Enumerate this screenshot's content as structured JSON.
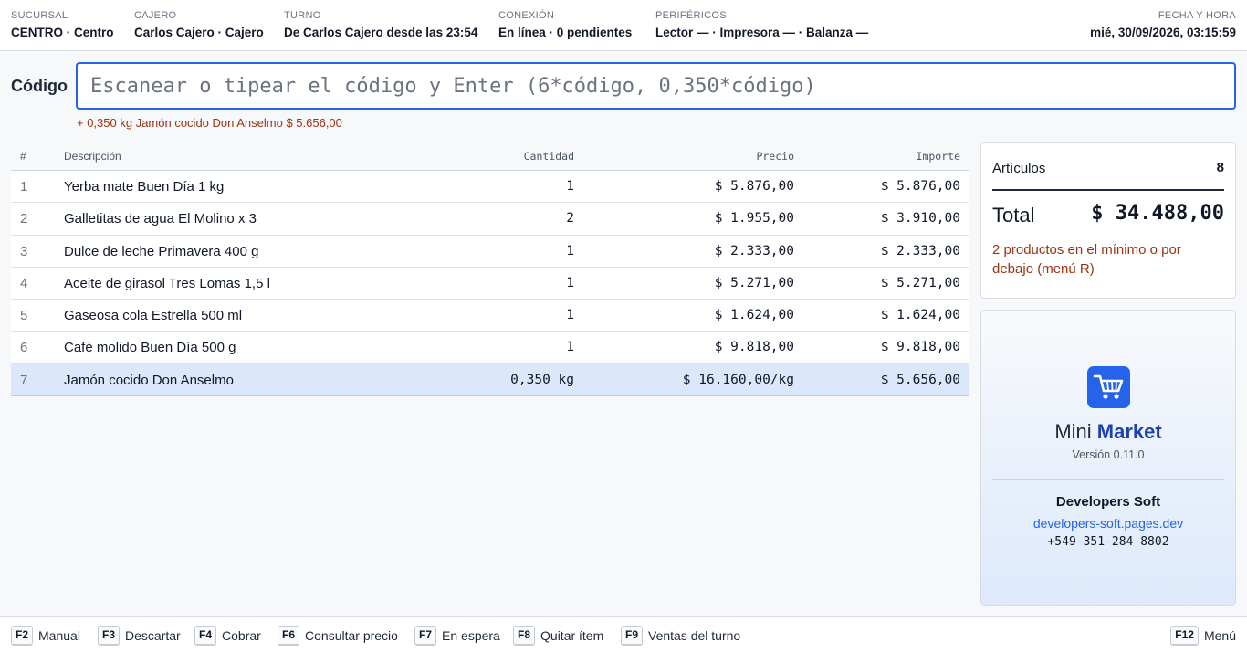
{
  "header": {
    "branch": {
      "label": "SUCURSAL",
      "value": "CENTRO · Centro"
    },
    "cashier": {
      "label": "CAJERO",
      "value": "Carlos Cajero · Cajero"
    },
    "shift": {
      "label": "TURNO",
      "value": "De Carlos Cajero desde las 23:54"
    },
    "connection": {
      "label": "CONEXIÓN",
      "value": "En línea · 0 pendientes"
    },
    "peripherals": {
      "label": "PERIFÉRICOS",
      "value": "Lector — · Impresora — · Balanza —"
    },
    "datetime": {
      "label": "FECHA Y HORA",
      "value": "mié, 30/09/2026, 03:15:59"
    }
  },
  "scan": {
    "label": "Código",
    "placeholder": "Escanear o tipear el código y Enter (6*código, 0,350*código)",
    "value": "",
    "last_added": "+ 0,350 kg Jamón cocido Don Anselmo $ 5.656,00"
  },
  "table": {
    "headers": {
      "num": "#",
      "desc": "Descripción",
      "qty": "Cantidad",
      "price": "Precio",
      "amount": "Importe"
    },
    "rows": [
      {
        "num": "1",
        "desc": "Yerba mate Buen Día 1 kg",
        "qty": "1",
        "price": "$ 5.876,00",
        "amount": "$ 5.876,00"
      },
      {
        "num": "2",
        "desc": "Galletitas de agua El Molino x 3",
        "qty": "2",
        "price": "$ 1.955,00",
        "amount": "$ 3.910,00"
      },
      {
        "num": "3",
        "desc": "Dulce de leche Primavera 400 g",
        "qty": "1",
        "price": "$ 2.333,00",
        "amount": "$ 2.333,00"
      },
      {
        "num": "4",
        "desc": "Aceite de girasol Tres Lomas 1,5 l",
        "qty": "1",
        "price": "$ 5.271,00",
        "amount": "$ 5.271,00"
      },
      {
        "num": "5",
        "desc": "Gaseosa cola Estrella 500 ml",
        "qty": "1",
        "price": "$ 1.624,00",
        "amount": "$ 1.624,00"
      },
      {
        "num": "6",
        "desc": "Café molido Buen Día 500 g",
        "qty": "1",
        "price": "$ 9.818,00",
        "amount": "$ 9.818,00"
      },
      {
        "num": "7",
        "desc": "Jamón cocido Don Anselmo",
        "qty": "0,350 kg",
        "price": "$ 16.160,00/kg",
        "amount": "$ 5.656,00"
      }
    ],
    "selected_index": 6
  },
  "summary": {
    "items_label": "Artículos",
    "items_count": "8",
    "total_label": "Total",
    "total_value": "$ 34.488,00",
    "warning": "2 productos en el mínimo o por debajo (menú R)"
  },
  "brand": {
    "name_light": "Mini ",
    "name_bold": "Market",
    "version": "Versión 0.11.0",
    "developer": "Developers Soft",
    "website": "developers-soft.pages.dev",
    "phone": "+549-351-284-8802",
    "logo_icon": "cart-icon",
    "accent_color": "#2563eb"
  },
  "footer": {
    "keys": [
      {
        "key": "F2",
        "label": "Manual"
      },
      {
        "key": "F3",
        "label": "Descartar"
      },
      {
        "key": "F4",
        "label": "Cobrar"
      },
      {
        "key": "F6",
        "label": "Consultar precio"
      },
      {
        "key": "F7",
        "label": "En espera"
      },
      {
        "key": "F8",
        "label": "Quitar ítem"
      },
      {
        "key": "F9",
        "label": "Ventas del turno"
      }
    ],
    "menu": {
      "key": "F12",
      "label": "Menú"
    }
  }
}
